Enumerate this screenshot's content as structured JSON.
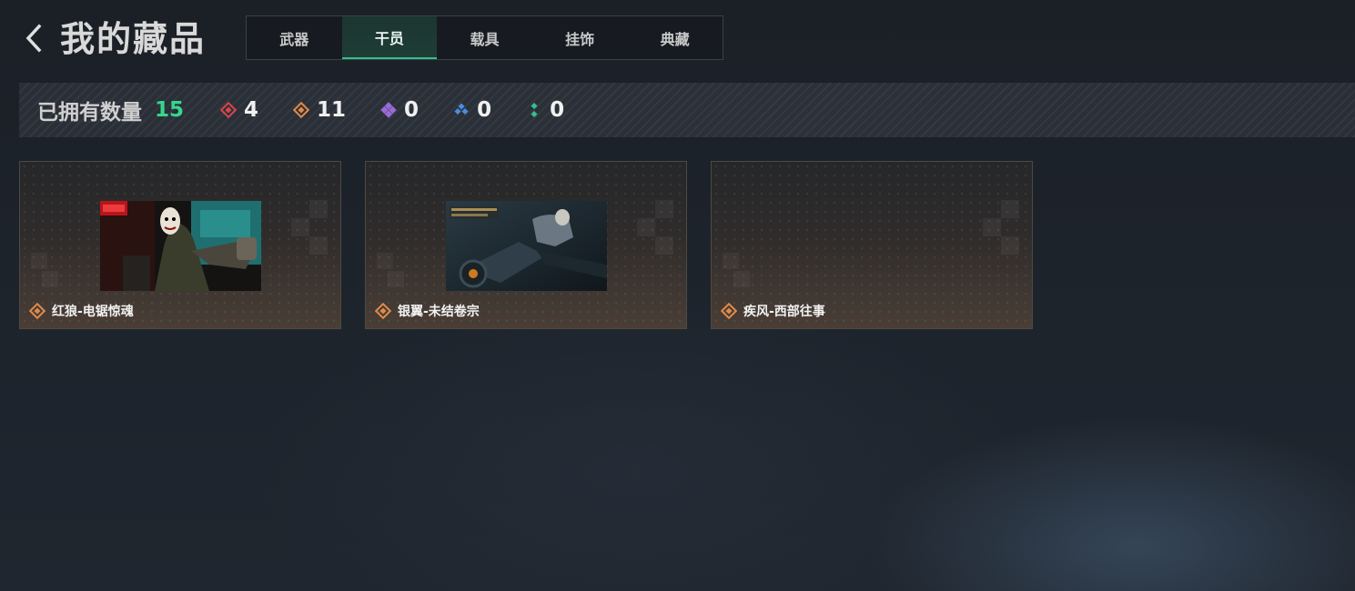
{
  "header": {
    "title": "我的藏品",
    "back_icon": "chevron-left-icon"
  },
  "tabs": [
    {
      "label": "武器",
      "active": false
    },
    {
      "label": "干员",
      "active": true
    },
    {
      "label": "载具",
      "active": false
    },
    {
      "label": "挂饰",
      "active": false
    },
    {
      "label": "典藏",
      "active": false
    }
  ],
  "stats": {
    "label": "已拥有数量",
    "total": "15",
    "total_color": "#36d68e",
    "rarities": [
      {
        "icon": "red-diamond-icon",
        "color": "#d9444c",
        "count": "4"
      },
      {
        "icon": "orange-diamond-icon",
        "color": "#e08a4a",
        "count": "11"
      },
      {
        "icon": "purple-diamond-icon",
        "color": "#9a6ad8",
        "count": "0"
      },
      {
        "icon": "blue-diamond-icon",
        "color": "#4a8de0",
        "count": "0"
      },
      {
        "icon": "green-dots-icon",
        "color": "#35c08c",
        "count": "0"
      }
    ]
  },
  "cards": [
    {
      "name": "红狼-电锯惊魂",
      "rarity_icon": "orange-diamond-icon",
      "thumbnail_icon": "skin-thumbnail-red-wolf",
      "has_thumbnail": true
    },
    {
      "name": "银翼-未结卷宗",
      "rarity_icon": "orange-diamond-icon",
      "thumbnail_icon": "skin-thumbnail-silver-wing",
      "has_thumbnail": true
    },
    {
      "name": "疾风-西部往事",
      "rarity_icon": "orange-diamond-icon",
      "thumbnail_icon": "",
      "has_thumbnail": false
    }
  ]
}
